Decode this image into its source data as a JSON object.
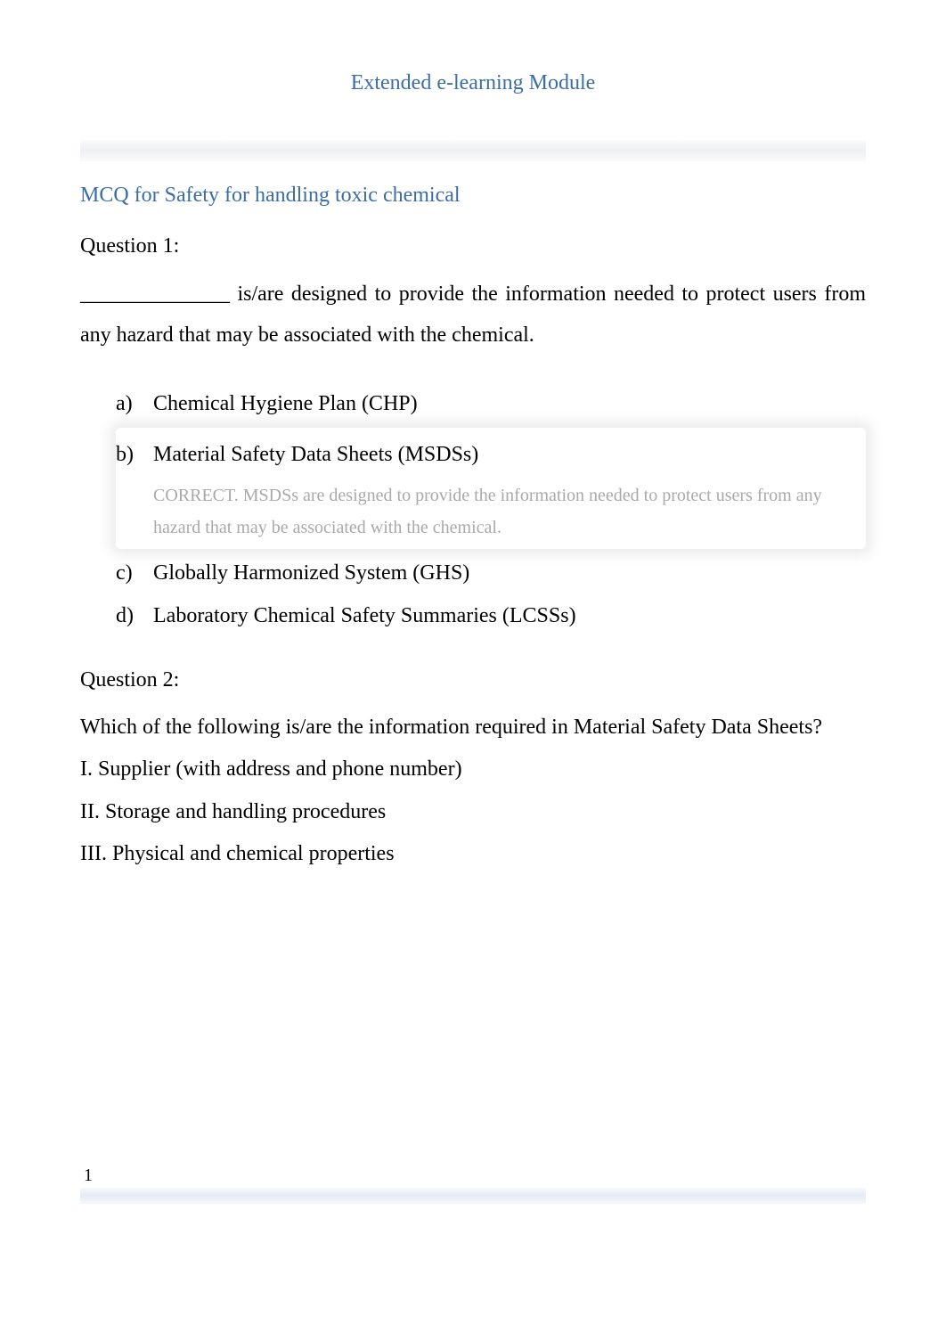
{
  "title": "Extended e-learning Module",
  "section_heading": "MCQ for Safety for handling toxic chemical",
  "q1": {
    "label": "Question 1:",
    "text": "______________ is/are designed to provide the information needed to protect users from any hazard that may be associated with the chemical.",
    "options": {
      "a": {
        "letter": "a)",
        "text": "Chemical Hygiene Plan (CHP)"
      },
      "b": {
        "letter": "b)",
        "text": "Material Safety Data Sheets (MSDSs)"
      },
      "c": {
        "letter": "c)",
        "text": "Globally Harmonized System (GHS)"
      },
      "d": {
        "letter": "d)",
        "text": "Laboratory Chemical Safety Summaries (LCSSs)"
      }
    },
    "correct_explanation": "CORRECT. MSDSs are designed to provide the information needed to protect users from any hazard that may be associated with the chemical."
  },
  "q2": {
    "label": "Question 2:",
    "stem": "Which of the following is/are the information required in Material Safety Data Sheets?",
    "items": {
      "i": "I. Supplier (with address and phone number)",
      "ii": "II. Storage and handling procedures",
      "iii": "III. Physical and chemical properties"
    }
  },
  "page_number": "1"
}
